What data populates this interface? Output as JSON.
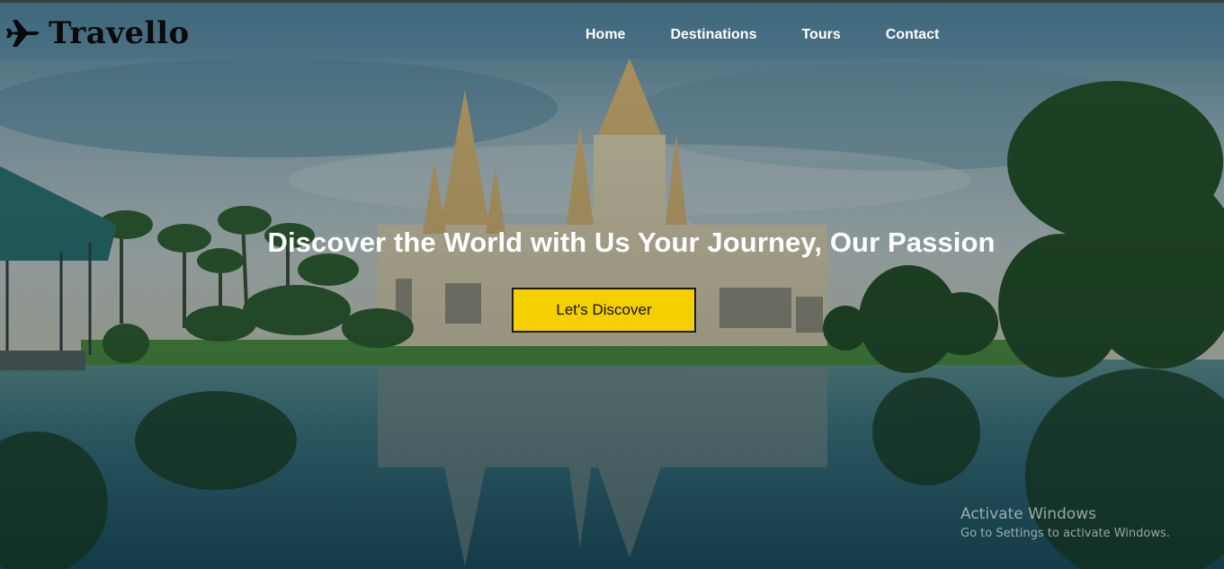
{
  "brand": {
    "name": "Travello",
    "icon": "airplane-icon"
  },
  "nav": {
    "items": [
      {
        "label": "Home"
      },
      {
        "label": "Destinations"
      },
      {
        "label": "Tours"
      },
      {
        "label": "Contact"
      }
    ]
  },
  "hero": {
    "title": "Discover the World with Us Your Journey, Our Passion",
    "cta_label": "Let's Discover",
    "background": "temple-lake-landscape-image"
  },
  "watermark": {
    "title": "Activate Windows",
    "subtitle": "Go to Settings to activate Windows."
  },
  "colors": {
    "cta_background": "#f5d000",
    "nav_text": "#ffffff",
    "logo_text": "#0a0a0a"
  }
}
